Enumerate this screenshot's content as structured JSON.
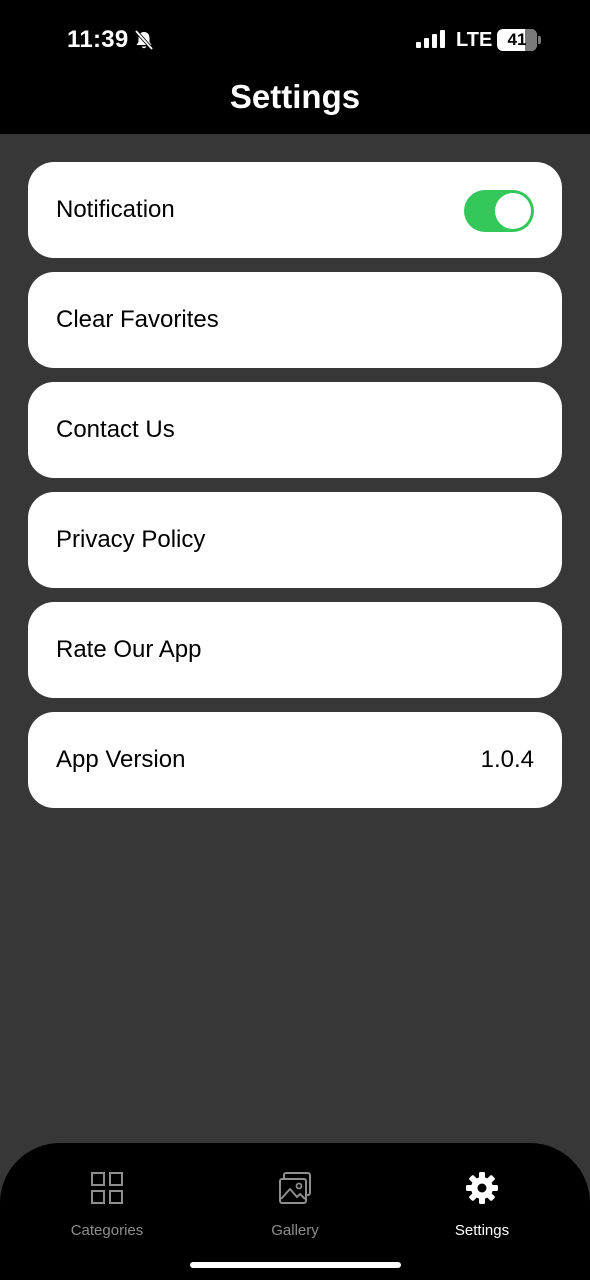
{
  "status_bar": {
    "time": "11:39",
    "network": "LTE",
    "battery_level": "41",
    "icons": [
      "bell-slash-icon",
      "signal-icon",
      "battery-icon"
    ]
  },
  "header": {
    "title": "Settings"
  },
  "settings": {
    "notification": {
      "label": "Notification",
      "toggle_on": true
    },
    "clear_favorites": {
      "label": "Clear Favorites"
    },
    "contact_us": {
      "label": "Contact Us"
    },
    "privacy_policy": {
      "label": "Privacy Policy"
    },
    "rate_app": {
      "label": "Rate Our App"
    },
    "app_version": {
      "label": "App Version",
      "value": "1.0.4"
    }
  },
  "tab_bar": {
    "tabs": [
      {
        "label": "Categories",
        "icon": "grid-icon",
        "active": false
      },
      {
        "label": "Gallery",
        "icon": "image-icon",
        "active": false
      },
      {
        "label": "Settings",
        "icon": "gear-icon",
        "active": true
      }
    ]
  },
  "colors": {
    "background": "#373737",
    "toggle_on": "#34c759",
    "tab_active": "#ffffff",
    "tab_inactive": "#8e8e8e"
  }
}
